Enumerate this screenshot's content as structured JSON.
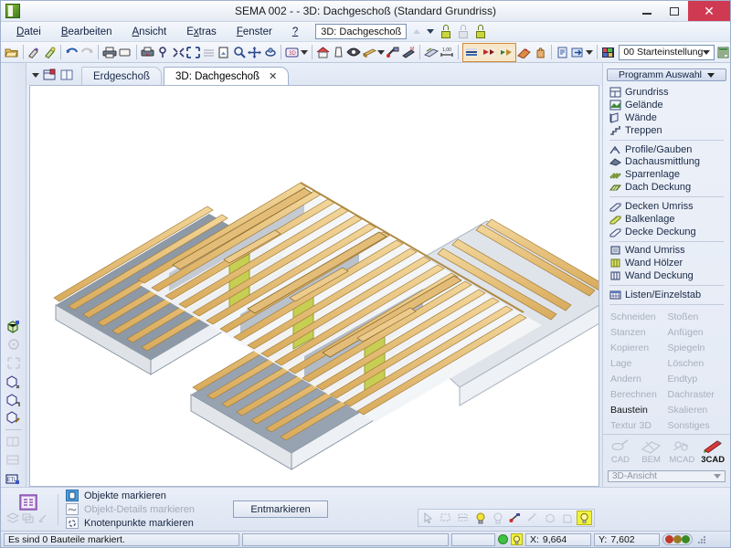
{
  "window": {
    "title": "SEMA  002 -   - 3D: Dachgeschoß (Standard Grundriss)",
    "app_icon": "sema-logo-icon",
    "minimize_label": "–",
    "maximize_label": "□",
    "close_label": "✕"
  },
  "menubar": {
    "items": [
      {
        "label": "Datei",
        "mnemonic": "D"
      },
      {
        "label": "Bearbeiten",
        "mnemonic": "B"
      },
      {
        "label": "Ansicht",
        "mnemonic": "A"
      },
      {
        "label": "Extras",
        "mnemonic": "x"
      },
      {
        "label": "Fenster",
        "mnemonic": "F"
      },
      {
        "label": "?",
        "mnemonic": "?"
      }
    ],
    "view_combo_value": "3D: Dachgeschoß",
    "locks": [
      "lock-green-icon",
      "lock-disabled-icon",
      "lock-green-icon"
    ]
  },
  "toolbar": {
    "buttons": [
      "open-folder-icon",
      "edit-pencil-icon",
      "paint-brush-icon",
      "undo-icon",
      "redo-icon",
      "print-icon",
      "page-setup-icon",
      "print-preview-icon",
      "query-icon",
      "zoom-region-icon",
      "zoom-extents-icon",
      "layers-icon",
      "screenshot-icon",
      "zoom-icon",
      "pan-icon",
      "orbit-icon",
      "view-3d-icon",
      "house-icon",
      "section-icon",
      "eye-icon",
      "beam-icon",
      "measure-icon",
      "info-icon",
      "render-icon",
      "dimension-icon"
    ],
    "selection_group": [
      "render-shade-icon",
      "render-color-icon",
      "render-texture-icon"
    ],
    "extra_buttons": [
      "perspective-icon",
      "hand-icon",
      "doc-icon",
      "export-icon"
    ],
    "setting_icon": "settings-grid-icon",
    "setting_value": "00 Starteinstellung"
  },
  "tabs": {
    "tools": [
      "dropdown-arrow-icon",
      "window-split-icon",
      "window-tile-icon"
    ],
    "items": [
      {
        "label": "Erdgeschoß",
        "active": false,
        "closable": false
      },
      {
        "label": "3D: Dachgeschoß",
        "active": true,
        "closable": true,
        "close_label": "✕"
      }
    ]
  },
  "viewport": {
    "name": "3d-roof-model",
    "description": "3D Dachgeschoß Sparrenlage Modell",
    "background": "#ffffff",
    "wood_color": "#e8c37a",
    "wood_dark": "#c79a4a",
    "slab_color": "#d9dde3",
    "slab_shade": "#93a0ad",
    "green_color": "#c9cf52"
  },
  "left_rail": {
    "buttons": [
      "cube-3d-icon",
      "rotate-disabled-icon",
      "fit-disabled-icon",
      "view-left-icon",
      "view-front-icon",
      "view-top-icon",
      "viewport-a-disabled-icon",
      "viewport-b-disabled-icon",
      "viewport-etl-icon"
    ]
  },
  "right_panel": {
    "program_button": {
      "label": "Programm Auswahl",
      "icon": "chevron-down-icon"
    },
    "groups": [
      {
        "items": [
          {
            "label": "Grundriss",
            "icon": "grundriss-icon"
          },
          {
            "label": "Gelände",
            "icon": "gelaende-icon"
          },
          {
            "label": "Wände",
            "icon": "waende-icon"
          },
          {
            "label": "Treppen",
            "icon": "treppen-icon"
          }
        ]
      },
      {
        "items": [
          {
            "label": "Profile/Gauben",
            "icon": "profile-gauben-icon"
          },
          {
            "label": "Dachausmittlung",
            "icon": "dachausmittlung-icon"
          },
          {
            "label": "Sparrenlage",
            "icon": "sparrenlage-icon"
          },
          {
            "label": "Dach Deckung",
            "icon": "dach-deckung-icon"
          }
        ]
      },
      {
        "items": [
          {
            "label": "Decken Umriss",
            "icon": "decken-umriss-icon"
          },
          {
            "label": "Balkenlage",
            "icon": "balkenlage-icon"
          },
          {
            "label": "Decke Deckung",
            "icon": "decke-deckung-icon"
          }
        ]
      },
      {
        "items": [
          {
            "label": "Wand Umriss",
            "icon": "wand-umriss-icon"
          },
          {
            "label": "Wand Hölzer",
            "icon": "wand-hoelzer-icon"
          },
          {
            "label": "Wand Deckung",
            "icon": "wand-deckung-icon"
          }
        ]
      },
      {
        "items": [
          {
            "label": "Listen/Einzelstab",
            "icon": "listen-einzelstab-icon"
          }
        ]
      }
    ],
    "command_grid": [
      {
        "label": "Schneiden",
        "enabled": false
      },
      {
        "label": "Stoßen",
        "enabled": false
      },
      {
        "label": "Stanzen",
        "enabled": false
      },
      {
        "label": "Anfügen",
        "enabled": false
      },
      {
        "label": "Kopieren",
        "enabled": false
      },
      {
        "label": "Spiegeln",
        "enabled": false
      },
      {
        "label": "Lage",
        "enabled": false
      },
      {
        "label": "Löschen",
        "enabled": false
      },
      {
        "label": "Andern",
        "enabled": false
      },
      {
        "label": "Endtyp",
        "enabled": false
      },
      {
        "label": "Berechnen",
        "enabled": false
      },
      {
        "label": "Dachraster",
        "enabled": false
      },
      {
        "label": "Baustein",
        "enabled": true
      },
      {
        "label": "Skalieren",
        "enabled": false
      },
      {
        "label": "Textur 3D",
        "enabled": false
      },
      {
        "label": "Sonstiges",
        "enabled": false
      }
    ],
    "modes": [
      {
        "label": "CAD",
        "icon": "cad-icon",
        "active": false
      },
      {
        "label": "BEM",
        "icon": "bem-icon",
        "active": false
      },
      {
        "label": "MCAD",
        "icon": "mcad-icon",
        "active": false
      },
      {
        "label": "3CAD",
        "icon": "3cad-icon",
        "active": true
      }
    ],
    "view_select": {
      "value": "3D-Ansicht",
      "icon": "chevron-down-icon"
    }
  },
  "bottom_panel": {
    "mode_icon": "marking-mode-icon",
    "sub_icons": [
      "stack-icon",
      "stack-alt-icon",
      "pick-icon"
    ],
    "mark_options": [
      {
        "label": "Objekte markieren",
        "icon": "objekt-icon",
        "enabled": true,
        "selected": true
      },
      {
        "label": "Objekt-Details markieren",
        "icon": "detail-icon",
        "enabled": false,
        "selected": false
      },
      {
        "label": "Knotenpunkte markieren",
        "icon": "knoten-icon",
        "enabled": true,
        "selected": false
      }
    ],
    "unmark_button": "Entmarkieren",
    "mini_tools": [
      "cursor-arrow-icon",
      "box-select-icon",
      "box-select-alt-icon",
      "bulb-on-icon",
      "bulb-off-icon",
      "magnet-icon",
      "magnet-alt-icon",
      "cube-a-icon",
      "cube-b-icon",
      "bulb-highlight-icon"
    ]
  },
  "statusbar": {
    "message": "Es sind 0 Bauteile markiert.",
    "secondary": "",
    "tertiary": "",
    "led": "green",
    "bulb_icon": "bulb-icon",
    "coord_x_label": "X:",
    "coord_x_value": "9,664",
    "coord_y_label": "Y:",
    "coord_y_value": "7,602",
    "traffic_lights": [
      "#c23a2a",
      "#9a7a22",
      "#3a8a22"
    ]
  },
  "colors": {
    "accent": "#cf3a52",
    "panel": "#e3e9f4",
    "border": "#9fb0cc",
    "selection_orange": "#d08a3a",
    "highlight_yellow": "#f2f23a"
  }
}
